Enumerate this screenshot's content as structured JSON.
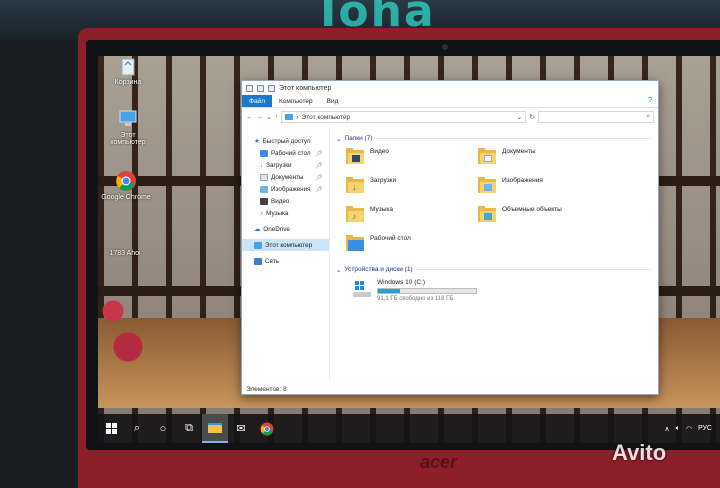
{
  "desktop": {
    "icons": [
      {
        "label": "Корзина"
      },
      {
        "label": "Этот компьютер"
      },
      {
        "label": "Google Chrome"
      },
      {
        "label": "1783 Ahoi"
      }
    ]
  },
  "window": {
    "title": "Этот компьютер",
    "ribbon_tabs": [
      "Файл",
      "Компьютер",
      "Вид"
    ],
    "address": "Этот компьютер",
    "nav": [
      {
        "label": "Быстрый доступ"
      },
      {
        "label": "Рабочий стол"
      },
      {
        "label": "Загрузки"
      },
      {
        "label": "Документы"
      },
      {
        "label": "Изображения"
      },
      {
        "label": "Видео"
      },
      {
        "label": "Музыка"
      },
      {
        "label": "OneDrive"
      },
      {
        "label": "Этот компьютер"
      },
      {
        "label": "Сеть"
      }
    ],
    "folders_header": "Папки (7)",
    "folders": [
      {
        "label": "Видео"
      },
      {
        "label": "Документы"
      },
      {
        "label": "Загрузки"
      },
      {
        "label": "Изображения"
      },
      {
        "label": "Музыка"
      },
      {
        "label": "Объемные объекты"
      },
      {
        "label": "Рабочий стол"
      }
    ],
    "devices_header": "Устройства и диски (1)",
    "drive": {
      "name": "Windows 10 (C:)",
      "free_text": "91,1 ГБ свободно из 118 ГБ",
      "used_fraction": 0.228
    },
    "status": "Элементов: 8"
  },
  "taskbar": {
    "language": "РУС"
  },
  "watermark": "Avito",
  "brand": "acer",
  "neon_sign": "Ioha",
  "colors": {
    "accent": "#1979ca",
    "folder": "#e8b84a",
    "selection": "#cce4f7",
    "laptop": "#8c1f2a"
  }
}
